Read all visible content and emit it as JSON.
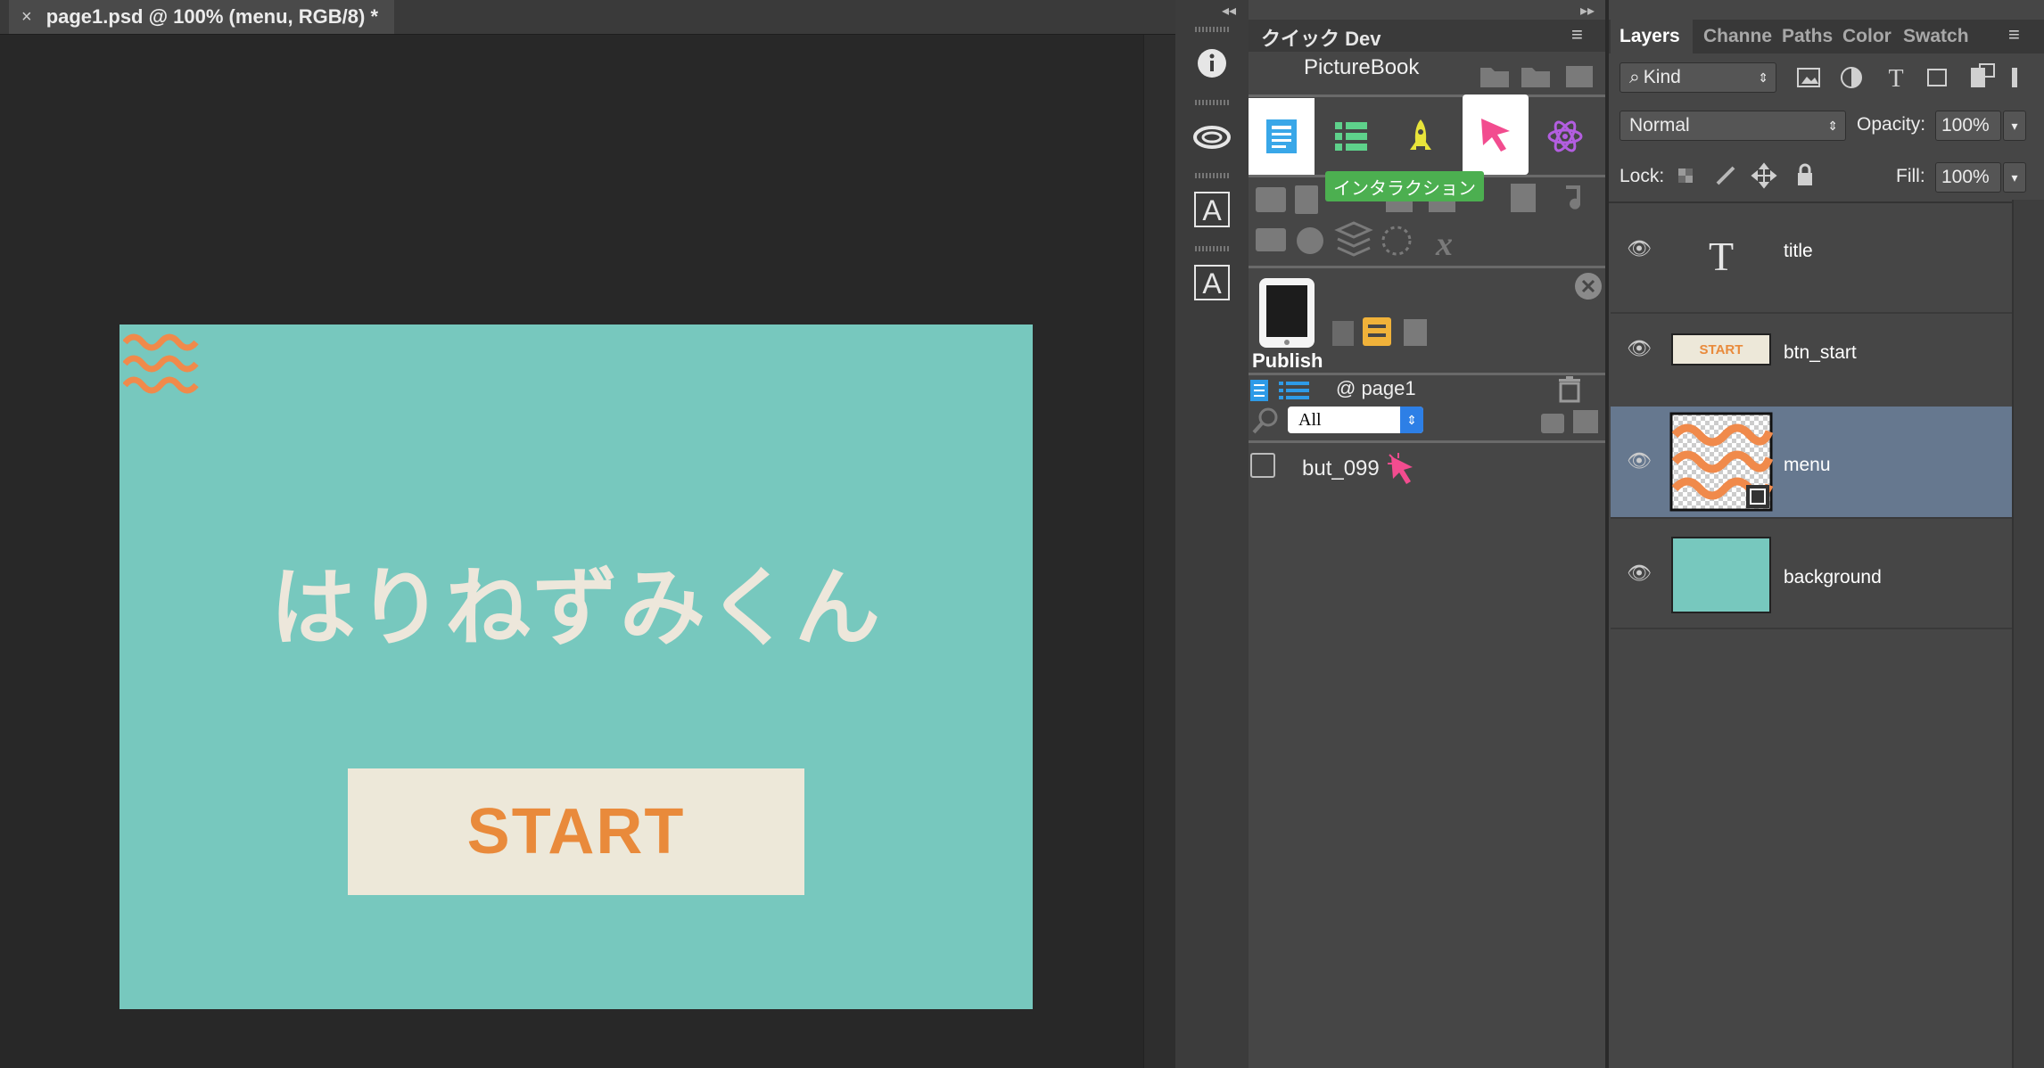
{
  "document": {
    "tab_close": "×",
    "tab_title": "page1.psd @ 100% (menu, RGB/8) *",
    "canvas_title": "はりねずみくん",
    "canvas_start": "START"
  },
  "toolstrip": {
    "collapse_left": "◂◂",
    "collapse_right": "▸▸",
    "tools": [
      "info-icon",
      "creative-cloud-icon",
      "type-a-icon",
      "type-a-icon"
    ]
  },
  "plugin": {
    "title": "クイック Dev",
    "menu_icon": "≡",
    "picturebook_label": "PictureBook",
    "tabs": [
      "page-icon",
      "list-icon",
      "rocket-icon",
      "pointer-icon",
      "atom-icon"
    ],
    "tooltip": "インタラクション",
    "publish_label": "Publish",
    "page_label": "@ page1",
    "filter_value": "All",
    "items": [
      {
        "label": "but_099"
      }
    ]
  },
  "layers": {
    "tabs": [
      "Layers",
      "Channe",
      "Paths",
      "Color",
      "Swatch"
    ],
    "menu_icon": "≡",
    "kind_label": "Kind",
    "blend_mode": "Normal",
    "opacity_label": "Opacity:",
    "opacity_value": "100%",
    "lock_label": "Lock:",
    "fill_label": "Fill:",
    "fill_value": "100%",
    "rows": [
      {
        "name": "title",
        "thumb_text": "T"
      },
      {
        "name": "btn_start",
        "thumb_text": "START"
      },
      {
        "name": "menu",
        "thumb_text": ""
      },
      {
        "name": "background",
        "thumb_text": ""
      }
    ],
    "selected_layer": "menu"
  },
  "colors": {
    "canvas_bg": "#77c8be",
    "start_text": "#e98a3b",
    "tooltip_bg": "#4caf50",
    "selected_row": "#66788f"
  }
}
